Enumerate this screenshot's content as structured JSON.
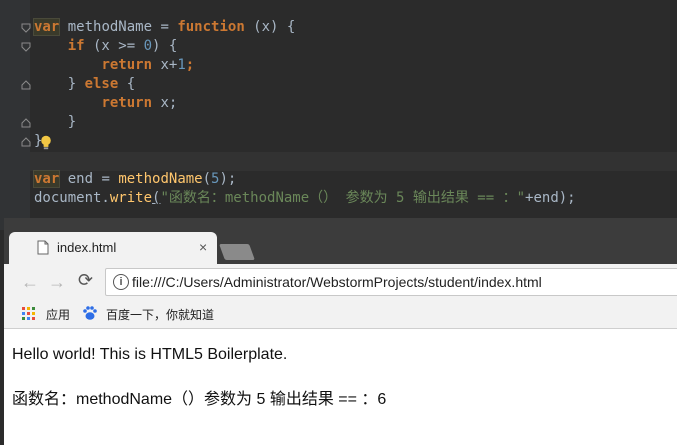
{
  "editor": {
    "lines": [
      {
        "kw_var": "var",
        "name": " methodName = ",
        "kw_fn": "function",
        "rest": " (x) {"
      },
      {
        "indent": "    ",
        "kw": "if",
        "pre": " (x >= ",
        "num": "0",
        "post": ") {"
      },
      {
        "indent": "        ",
        "kw": "return",
        "pre": " x+",
        "num": "1",
        "post": ";"
      },
      {
        "indent": "    ",
        "pre": "} ",
        "kw": "else",
        "post": " {"
      },
      {
        "indent": "        ",
        "kw": "return",
        "post": " x;"
      },
      {
        "indent": "    ",
        "post": "}"
      },
      {
        "post": "}"
      },
      {
        "post": ""
      },
      {
        "kw_var": "var",
        "name": " end = ",
        "fn": "methodName",
        "pre": "(",
        "num": "5",
        "post": ");"
      },
      {
        "obj": "document.",
        "call": "write",
        "paren": "(",
        "str": "\"函数名：methodName（） 参数为 5 输出结果 == ：\"",
        "post": "+end);"
      }
    ],
    "icons": {
      "fold": "fold-marker-icon",
      "bulb": "lightbulb-icon"
    }
  },
  "browser": {
    "tab": {
      "title": "index.html",
      "close": "×"
    },
    "nav": {
      "back": "←",
      "forward": "→",
      "reload": "⟳"
    },
    "address": {
      "url": "file:///C:/Users/Administrator/WebstormProjects/student/index.html"
    },
    "bookmarks": [
      {
        "label": "应用",
        "icon": "apps-grid-icon"
      },
      {
        "label": "百度一下，你就知道",
        "icon": "baidu-paw-icon"
      }
    ],
    "page": {
      "line1": "Hello world! This is HTML5 Boilerplate.",
      "line2": "函数名：methodName（）参数为 5 输出结果 == ：6"
    }
  },
  "colors": {
    "editor_bg": "#2b2b2b",
    "keyword": "#cc7832",
    "function": "#ffc66d",
    "number": "#6897bb",
    "string": "#6a8759"
  }
}
